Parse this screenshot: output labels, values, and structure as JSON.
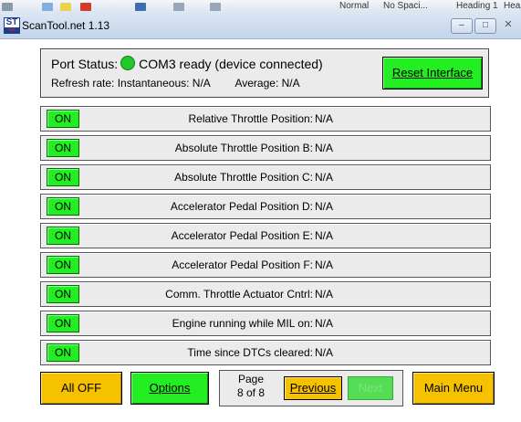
{
  "ribbon": {
    "styles": [
      "Normal",
      "No Spaci...",
      "Heading 1",
      "Hea"
    ]
  },
  "window": {
    "title": "ScanTool.net 1.13",
    "logo_text": "ST",
    "logo_subtext": "net",
    "minimize_glyph": "–",
    "maximize_glyph": "□",
    "close_glyph": "✕"
  },
  "status": {
    "port_label": "Port Status:",
    "port_value": "COM3 ready (device connected)",
    "indicator_color": "#22c92a",
    "refresh_label": "Refresh rate:",
    "instantaneous": "Instantaneous: N/A",
    "average": "Average: N/A",
    "reset_button": "Reset Interface"
  },
  "pids": [
    {
      "toggle": "ON",
      "label": "Relative Throttle Position:",
      "value": "N/A"
    },
    {
      "toggle": "ON",
      "label": "Absolute Throttle Position B:",
      "value": "N/A"
    },
    {
      "toggle": "ON",
      "label": "Absolute Throttle Position C:",
      "value": "N/A"
    },
    {
      "toggle": "ON",
      "label": "Accelerator Pedal Position D:",
      "value": "N/A"
    },
    {
      "toggle": "ON",
      "label": "Accelerator Pedal Position E:",
      "value": "N/A"
    },
    {
      "toggle": "ON",
      "label": "Accelerator Pedal Position F:",
      "value": "N/A"
    },
    {
      "toggle": "ON",
      "label": "Comm. Throttle Actuator Cntrl:",
      "value": "N/A"
    },
    {
      "toggle": "ON",
      "label": "Engine running while MIL on:",
      "value": "N/A"
    },
    {
      "toggle": "ON",
      "label": "Time since DTCs cleared:",
      "value": "N/A"
    }
  ],
  "footer": {
    "all_off": "All OFF",
    "options": "Options",
    "page_word": "Page",
    "page_of": "8 of 8",
    "previous": "Previous",
    "next": "Next",
    "main_menu": "Main Menu"
  },
  "colors": {
    "on_green": "#22ee22",
    "amber": "#f6c200",
    "panel_gray": "#ebebeb"
  }
}
